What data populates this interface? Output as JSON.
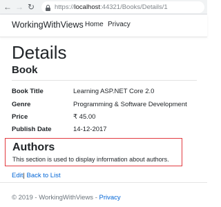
{
  "browser": {
    "back_icon": "arrow-left",
    "forward_icon": "arrow-right",
    "reload_icon": "reload",
    "url_scheme": "https://",
    "url_host": "localhost",
    "url_rest": ":44321/Books/Details/1"
  },
  "navbar": {
    "brand": "WorkingWithViews",
    "links": [
      "Home",
      "Privacy"
    ]
  },
  "page": {
    "title": "Details",
    "subtitle": "Book"
  },
  "details": [
    {
      "label": "Book Title",
      "value": "Learning ASP.NET Core 2.0"
    },
    {
      "label": "Genre",
      "value": "Programming & Software Development"
    },
    {
      "label": "Price",
      "value": "₹ 45.00"
    },
    {
      "label": "Publish Date",
      "value": "14-12-2017"
    }
  ],
  "authors": {
    "title": "Authors",
    "text": "This section is used to display information about authors.",
    "highlight_color": "#e2393f"
  },
  "actions": {
    "edit": "Edit",
    "separator": "|",
    "back": "Back to List"
  },
  "footer": {
    "text": "© 2019 - WorkingWithViews - ",
    "link": "Privacy"
  },
  "colors": {
    "link": "#0366d6",
    "text": "#212529",
    "muted": "#6c757d"
  }
}
